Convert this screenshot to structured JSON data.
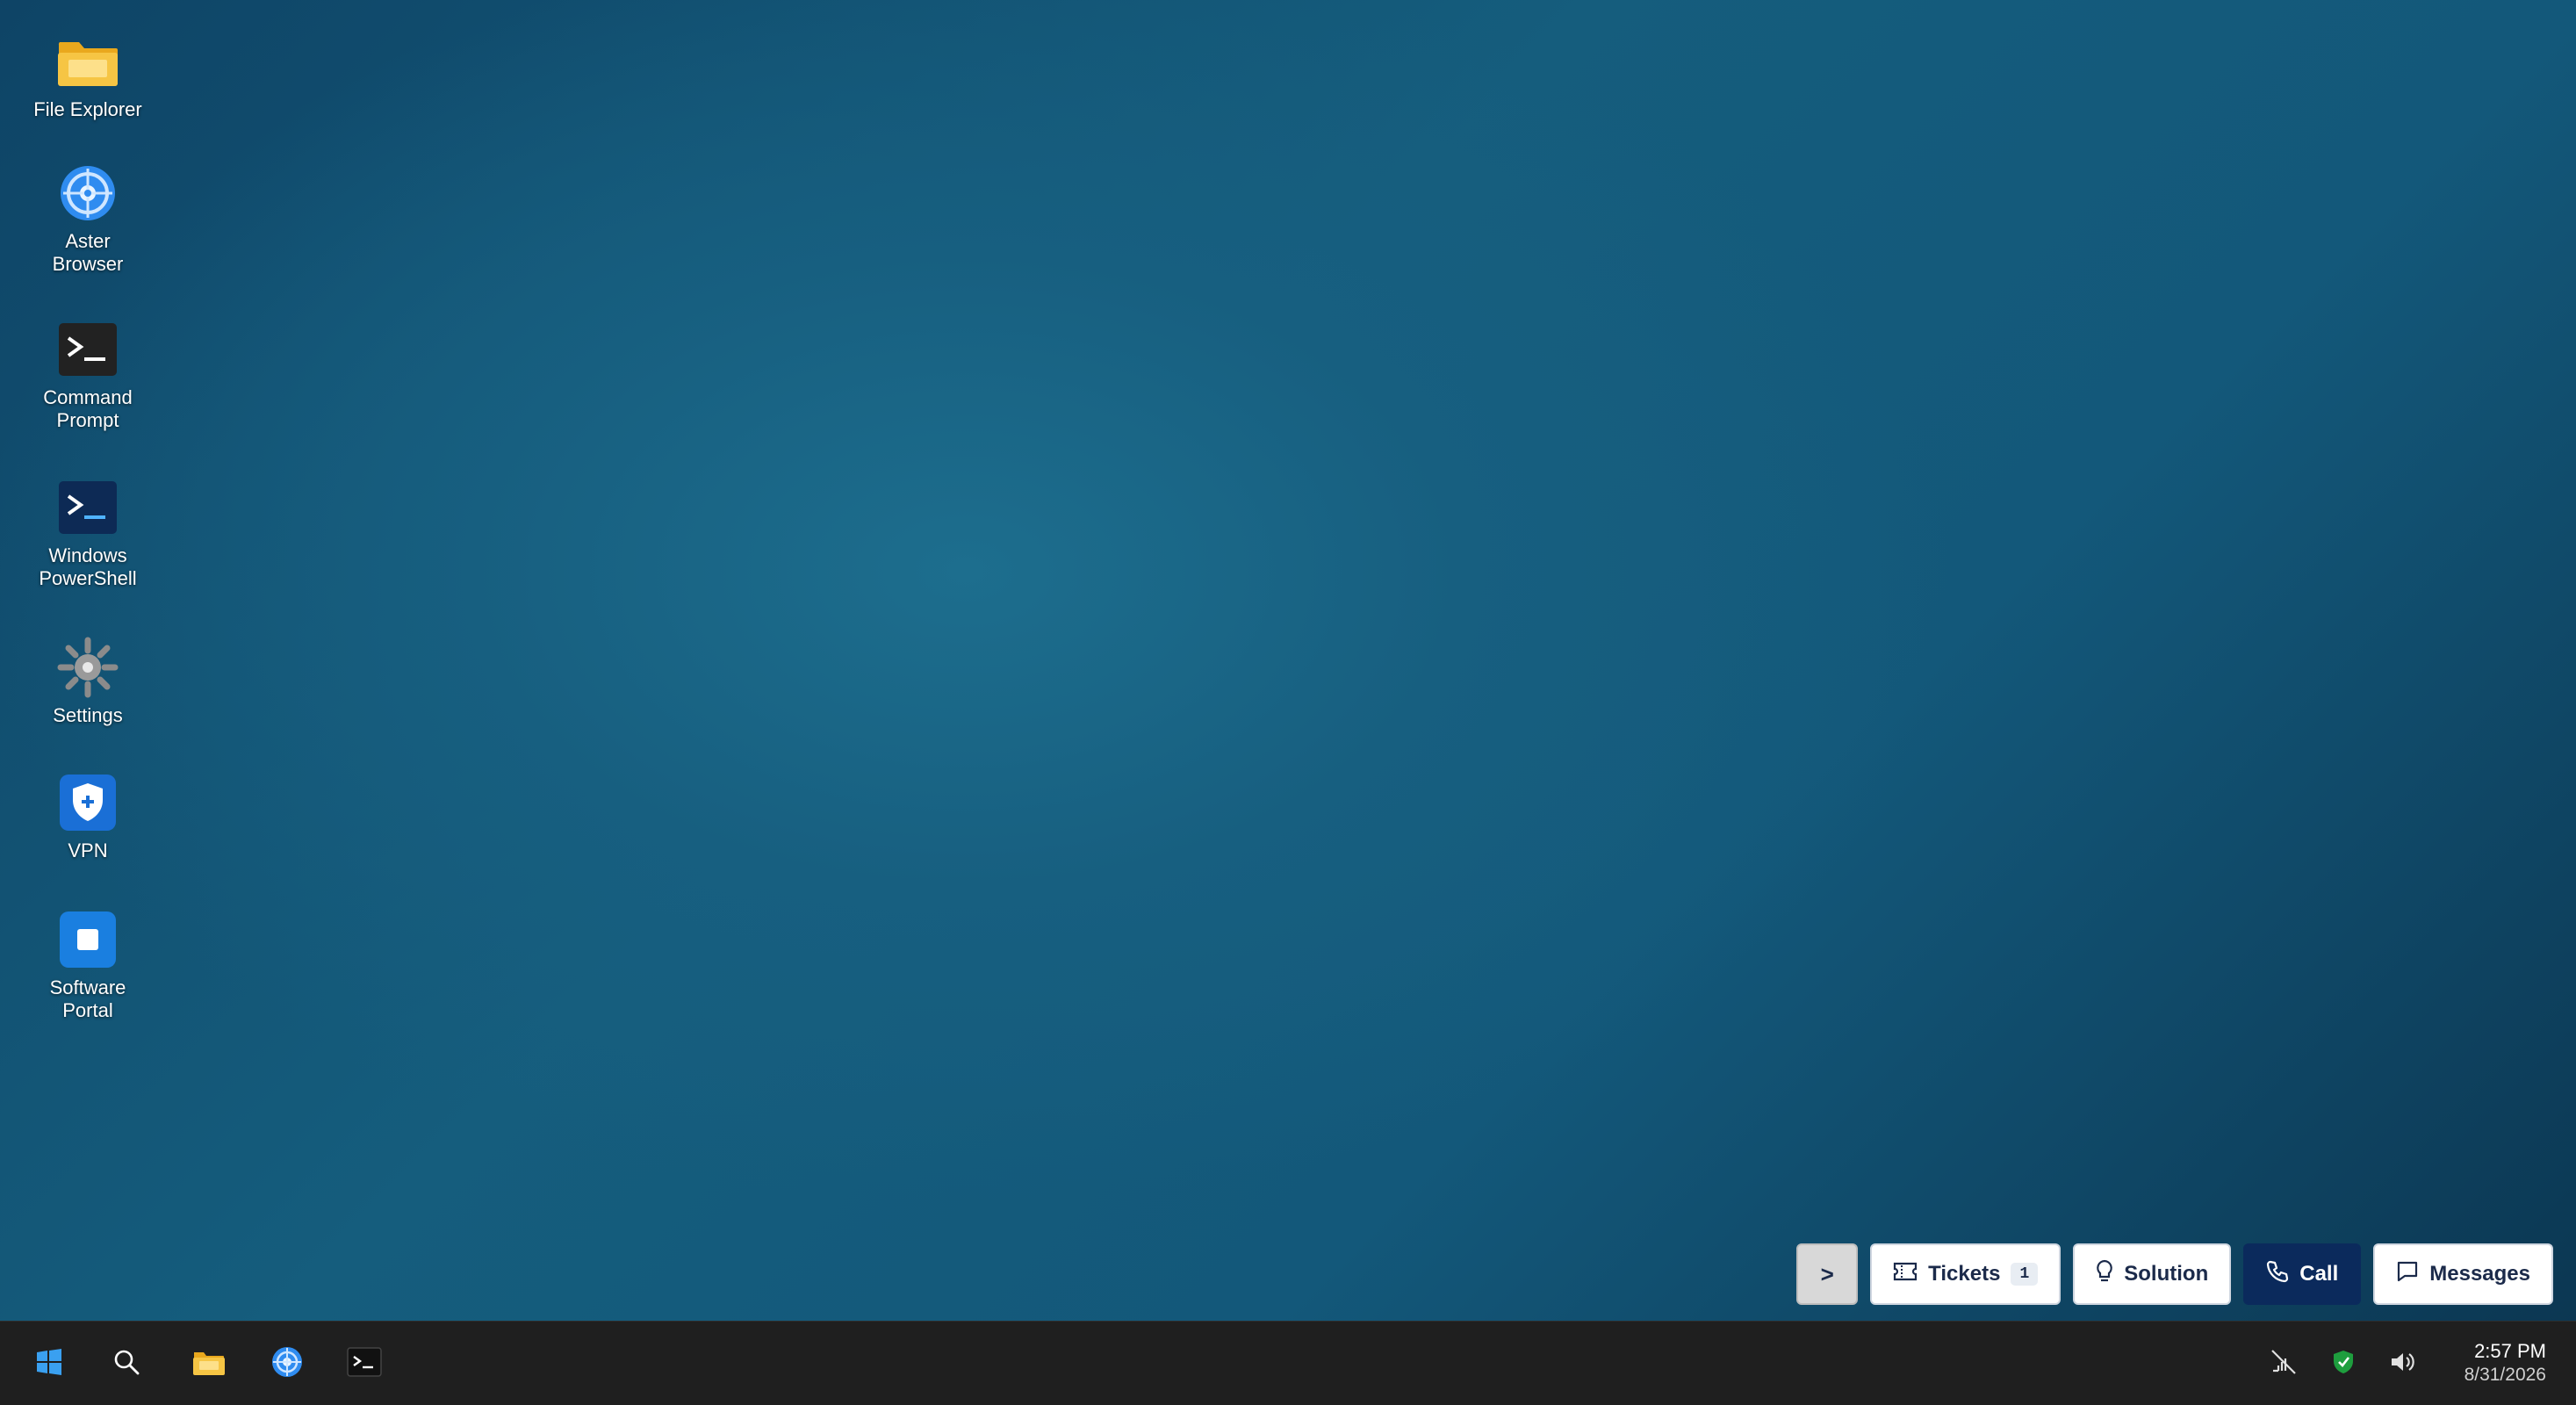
{
  "desktop": {
    "icons": [
      {
        "label": "File Explorer",
        "icon": "folder-icon"
      },
      {
        "label": "Aster\nBrowser",
        "icon": "browser-icon"
      },
      {
        "label": "Command\nPrompt",
        "icon": "terminal-icon"
      },
      {
        "label": "Windows\nPowerShell",
        "icon": "powershell-icon"
      },
      {
        "label": "Settings",
        "icon": "gear-icon"
      },
      {
        "label": "VPN",
        "icon": "shield-icon"
      },
      {
        "label": "Software\nPortal",
        "icon": "store-icon"
      }
    ]
  },
  "action_bar": {
    "collapse_label": ">",
    "tickets_label": "Tickets",
    "tickets_count": "1",
    "solution_label": "Solution",
    "call_label": "Call",
    "messages_label": "Messages"
  },
  "taskbar": {
    "start_icon": "windows-logo-icon",
    "search_icon": "search-icon",
    "pinned": [
      "folder-icon",
      "browser-icon",
      "terminal-icon"
    ],
    "tray": [
      "network-disconnected-icon",
      "security-shield-icon",
      "volume-icon"
    ],
    "time": "2:57 PM",
    "date": "8/31/2026"
  },
  "colors": {
    "accent_call": "#0b2a5c",
    "folder": "#f2b82c",
    "browser": "#2f8cf0",
    "taskbar": "#1f1f1f"
  }
}
